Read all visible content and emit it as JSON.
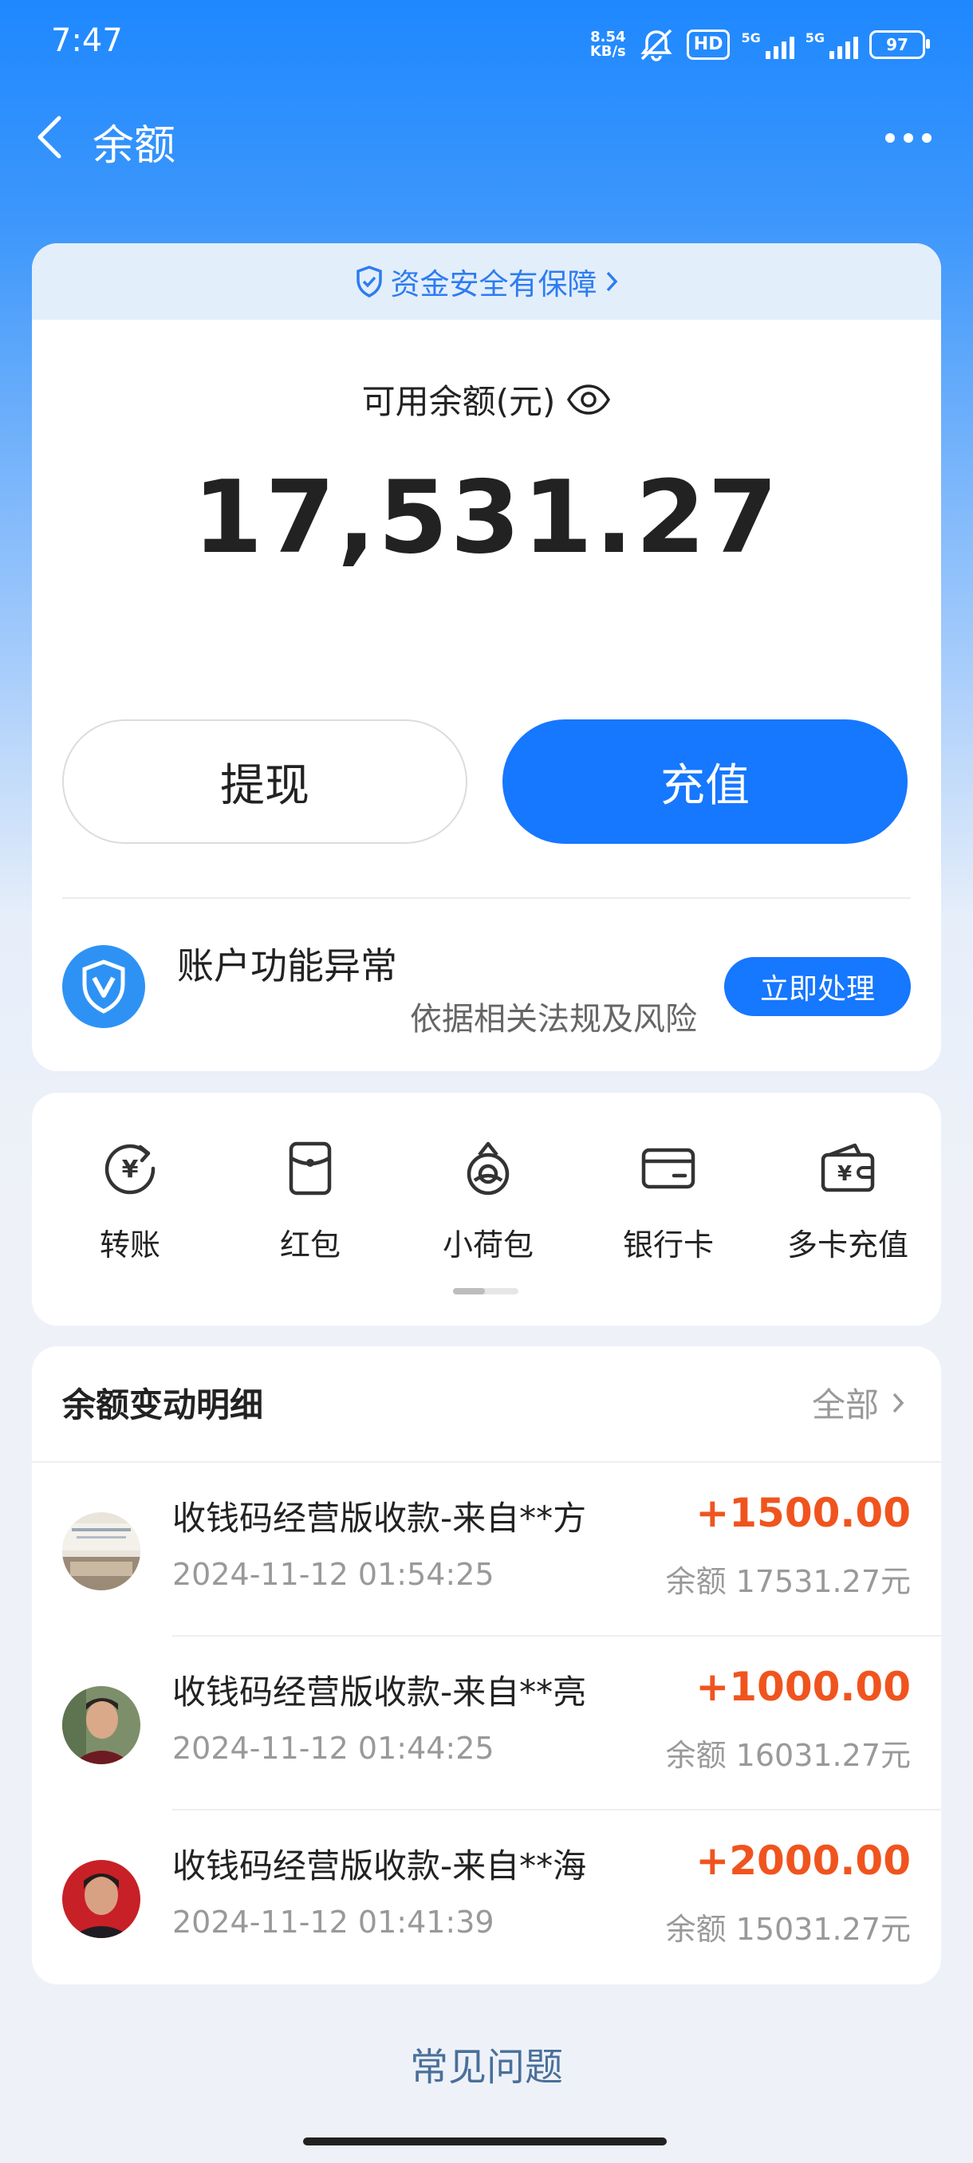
{
  "status_bar": {
    "time": "7:47",
    "net_speed_value": "8.54",
    "net_speed_unit": "KB/s",
    "hd_label": "HD",
    "signal1_label": "5G",
    "signal2_label": "5G",
    "battery": "97"
  },
  "header": {
    "title": "余额"
  },
  "balance": {
    "safety_text": "资金安全有保障",
    "label": "可用余额(元)",
    "amount": "17,531.27",
    "withdraw_label": "提现",
    "recharge_label": "充值"
  },
  "alert": {
    "title": "账户功能异常",
    "subtitle": "依据相关法规及风险",
    "button_label": "立即处理"
  },
  "functions": [
    {
      "label": "转账",
      "icon": "transfer-yuan-icon"
    },
    {
      "label": "红包",
      "icon": "red-packet-icon"
    },
    {
      "label": "小荷包",
      "icon": "small-pouch-icon"
    },
    {
      "label": "银行卡",
      "icon": "bank-card-icon"
    },
    {
      "label": "多卡充值",
      "icon": "multi-card-wallet-icon"
    }
  ],
  "details": {
    "header": "余额变动明细",
    "all_label": "全部",
    "rows": [
      {
        "title": "收钱码经营版收款-来自**方",
        "time": "2024-11-12 01:54:25",
        "amount": "+1500.00",
        "balance": "余额 17531.27元"
      },
      {
        "title": "收钱码经营版收款-来自**亮",
        "time": "2024-11-12 01:44:25",
        "amount": "+1000.00",
        "balance": "余额 16031.27元"
      },
      {
        "title": "收钱码经营版收款-来自**海",
        "time": "2024-11-12 01:41:39",
        "amount": "+2000.00",
        "balance": "余额 15031.27元"
      }
    ]
  },
  "footer": {
    "faq_label": "常见问题"
  },
  "colors": {
    "accent": "#1677ff",
    "income": "#f0541e"
  }
}
